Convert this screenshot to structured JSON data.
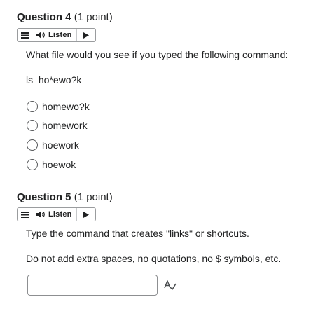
{
  "questions": [
    {
      "title": "Question 4",
      "points": "(1 point)",
      "listen_label": "Listen",
      "prompt": "What file would you see if you typed the following command:",
      "command": "ls  ho*ewo?k",
      "options": [
        "homewo?k",
        "homework",
        "hoework",
        "hoewok"
      ]
    },
    {
      "title": "Question 5",
      "points": "(1 point)",
      "listen_label": "Listen",
      "prompt": "Type the command that creates \"links\" or shortcuts.",
      "instruction": "Do not add extra spaces, no quotations, no $ symbols, etc.",
      "answer_value": ""
    }
  ],
  "icons": {
    "menu": "hamburger-menu-icon",
    "speaker": "speaker-icon",
    "play": "play-icon",
    "spellcheck": "spellcheck-icon"
  }
}
